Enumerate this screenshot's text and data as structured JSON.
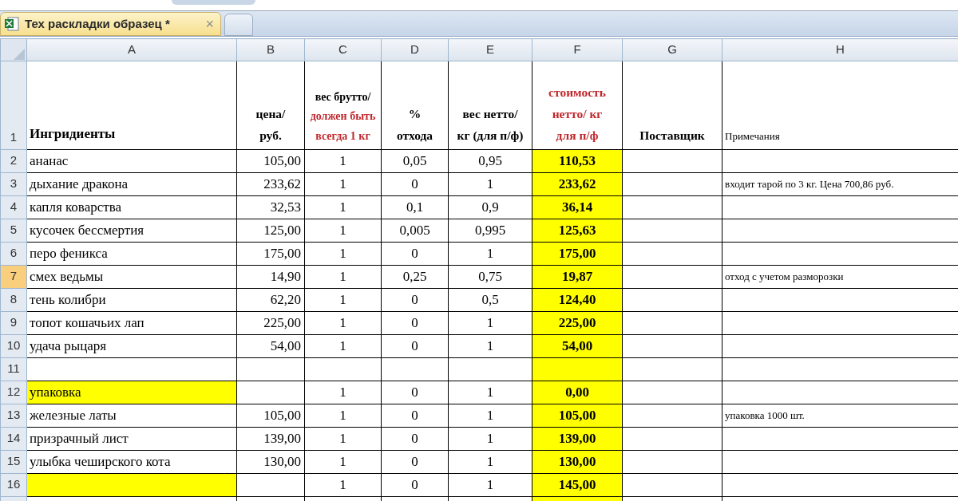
{
  "tab": {
    "title": "Тех раскладки образец *",
    "close": "×"
  },
  "columns": [
    {
      "letter": "A",
      "highlighted": false
    },
    {
      "letter": "B",
      "highlighted": false
    },
    {
      "letter": "C",
      "highlighted": false
    },
    {
      "letter": "D",
      "highlighted": false
    },
    {
      "letter": "E",
      "highlighted": false
    },
    {
      "letter": "F",
      "highlighted": true
    },
    {
      "letter": "G",
      "highlighted": false
    },
    {
      "letter": "H",
      "highlighted": false
    }
  ],
  "header_row": {
    "number": "1",
    "selected": false,
    "cells": [
      {
        "bold": true,
        "parts": [
          {
            "text": "Ингридиенты",
            "accent": false
          }
        ]
      },
      {
        "bold": true,
        "parts": [
          {
            "text": "цена/ руб.",
            "accent": false
          }
        ]
      },
      {
        "bold": true,
        "parts": [
          {
            "text": "вес брутто/",
            "accent": false
          },
          {
            "text": "должен быть всегда 1 кг",
            "accent": true
          }
        ]
      },
      {
        "bold": true,
        "parts": [
          {
            "text": "% отхода",
            "accent": false
          }
        ]
      },
      {
        "bold": true,
        "parts": [
          {
            "text": "вес нетто/кг (для п/ф)",
            "accent": false
          }
        ]
      },
      {
        "bold": true,
        "parts": [
          {
            "text": "стоимость нетто/ кг для п/ф",
            "accent": true
          }
        ]
      },
      {
        "bold": true,
        "parts": [
          {
            "text": "Поставщик",
            "accent": false
          }
        ]
      },
      {
        "bold": false,
        "parts": [
          {
            "text": "Примечания",
            "accent": false
          }
        ]
      }
    ]
  },
  "rows": [
    {
      "number": "2",
      "selected": false,
      "label_highlighted": false,
      "cells": [
        "ананас",
        "105,00",
        "1",
        "0,05",
        "0,95",
        "110,53",
        "",
        ""
      ]
    },
    {
      "number": "3",
      "selected": false,
      "label_highlighted": false,
      "cells": [
        "дыхание дракона",
        "233,62",
        "1",
        "0",
        "1",
        "233,62",
        "",
        "входит тарой по 3 кг. Цена 700,86 руб."
      ]
    },
    {
      "number": "4",
      "selected": false,
      "label_highlighted": false,
      "cells": [
        "капля коварства",
        "32,53",
        "1",
        "0,1",
        "0,9",
        "36,14",
        "",
        ""
      ]
    },
    {
      "number": "5",
      "selected": false,
      "label_highlighted": false,
      "cells": [
        "кусочек бессмертия",
        "125,00",
        "1",
        "0,005",
        "0,995",
        "125,63",
        "",
        ""
      ]
    },
    {
      "number": "6",
      "selected": false,
      "label_highlighted": false,
      "cells": [
        "перо феникса",
        "175,00",
        "1",
        "0",
        "1",
        "175,00",
        "",
        ""
      ]
    },
    {
      "number": "7",
      "selected": true,
      "label_highlighted": false,
      "cells": [
        "смех ведьмы",
        "14,90",
        "1",
        "0,25",
        "0,75",
        "19,87",
        "",
        "отход с учетом разморозки"
      ]
    },
    {
      "number": "8",
      "selected": false,
      "label_highlighted": false,
      "cells": [
        "тень колибри",
        "62,20",
        "1",
        "0",
        "0,5",
        "124,40",
        "",
        ""
      ]
    },
    {
      "number": "9",
      "selected": false,
      "label_highlighted": false,
      "cells": [
        "топот кошачьих лап",
        "225,00",
        "1",
        "0",
        "1",
        "225,00",
        "",
        ""
      ]
    },
    {
      "number": "10",
      "selected": false,
      "label_highlighted": false,
      "cells": [
        "удача рыцаря",
        "54,00",
        "1",
        "0",
        "1",
        "54,00",
        "",
        ""
      ]
    },
    {
      "number": "11",
      "selected": false,
      "label_highlighted": false,
      "cells": [
        "",
        "",
        "",
        "",
        "",
        "",
        "",
        ""
      ]
    },
    {
      "number": "12",
      "selected": false,
      "label_highlighted": true,
      "cells": [
        "упаковка",
        "",
        "1",
        "0",
        "1",
        "0,00",
        "",
        ""
      ]
    },
    {
      "number": "13",
      "selected": false,
      "label_highlighted": false,
      "cells": [
        "железные латы",
        "105,00",
        "1",
        "0",
        "1",
        "105,00",
        "",
        "упаковка 1000 шт."
      ]
    },
    {
      "number": "14",
      "selected": false,
      "label_highlighted": false,
      "cells": [
        "призрачный лист",
        "139,00",
        "1",
        "0",
        "1",
        "139,00",
        "",
        ""
      ]
    },
    {
      "number": "15",
      "selected": false,
      "label_highlighted": false,
      "cells": [
        "улыбка чеширского кота",
        "130,00",
        "1",
        "0",
        "1",
        "130,00",
        "",
        ""
      ]
    },
    {
      "number": "16",
      "selected": false,
      "label_highlighted": true,
      "cells": [
        "",
        "",
        "1",
        "0",
        "1",
        "145,00",
        "",
        ""
      ]
    }
  ]
}
